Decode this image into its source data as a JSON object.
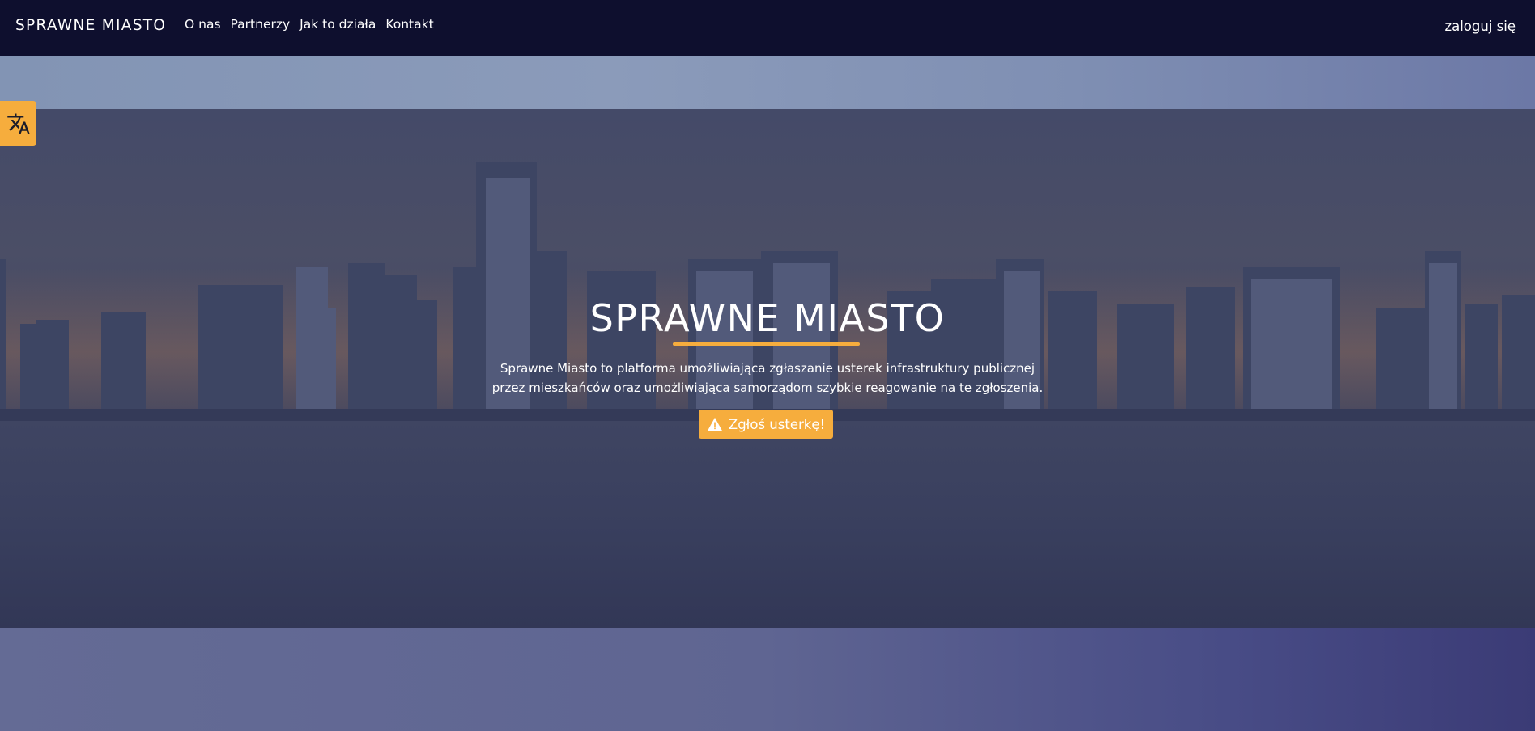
{
  "navbar": {
    "brand": "SPRAWNE MIASTO",
    "links": [
      "O nas",
      "Partnerzy",
      "Jak to działa",
      "Kontakt"
    ],
    "login": "zaloguj się"
  },
  "translate": {
    "icon": "translate-icon"
  },
  "hero": {
    "title": "SPRAWNE MIASTO",
    "description_line1": "Sprawne Miasto to platforma umożliwiająca zgłaszanie usterek infrastruktury publicznej",
    "description_line2": "przez mieszkańców oraz umożliwiająca samorządom szybkie reagowanie na te zgłoszenia.",
    "cta_label": "Zgłoś usterkę!",
    "cta_icon": "warning-icon"
  },
  "colors": {
    "navbar_bg": "#0e0f2e",
    "accent": "#f6ad3d",
    "text": "#ffffff"
  }
}
